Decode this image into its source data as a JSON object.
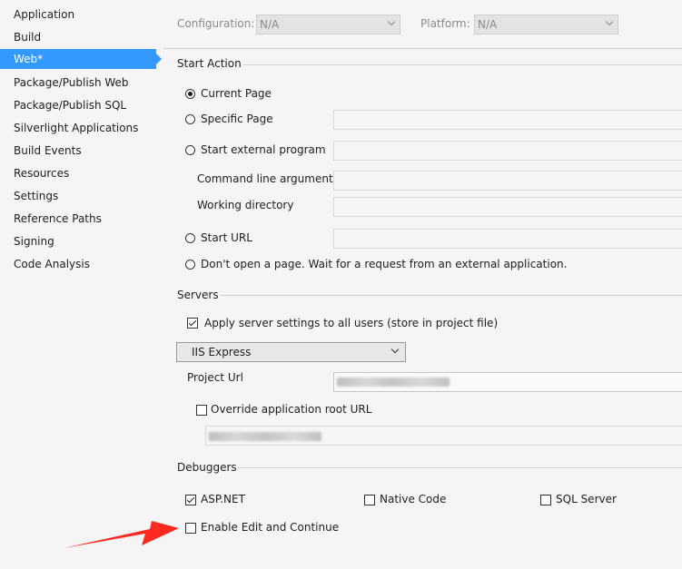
{
  "sidebar": {
    "items": [
      {
        "label": "Application"
      },
      {
        "label": "Build"
      },
      {
        "label": "Web*"
      },
      {
        "label": "Package/Publish Web"
      },
      {
        "label": "Package/Publish SQL"
      },
      {
        "label": "Silverlight Applications"
      },
      {
        "label": "Build Events"
      },
      {
        "label": "Resources"
      },
      {
        "label": "Settings"
      },
      {
        "label": "Reference Paths"
      },
      {
        "label": "Signing"
      },
      {
        "label": "Code Analysis"
      }
    ],
    "active_index": 2
  },
  "topbar": {
    "configuration_label": "Configuration:",
    "configuration_value": "N/A",
    "platform_label": "Platform:",
    "platform_value": "N/A"
  },
  "start_action": {
    "title": "Start Action",
    "current_page": "Current Page",
    "specific_page": "Specific Page",
    "start_external_program": "Start external program",
    "command_line_arguments": "Command line arguments",
    "working_directory": "Working directory",
    "start_url": "Start URL",
    "dont_open": "Don't open a page.  Wait for a request from an external application.",
    "selected": "current_page"
  },
  "servers": {
    "title": "Servers",
    "apply_settings": "Apply server settings to all users (store in project file)",
    "apply_settings_checked": true,
    "server_value": "IIS Express",
    "project_url_label": "Project Url",
    "override_root": "Override application root URL",
    "override_root_checked": false
  },
  "debuggers": {
    "title": "Debuggers",
    "aspnet": "ASP.NET",
    "aspnet_checked": true,
    "native_code": "Native Code",
    "native_code_checked": false,
    "sql_server": "SQL Server",
    "sql_server_checked": false,
    "edit_continue": "Enable Edit and Continue",
    "edit_continue_checked": false
  },
  "colors": {
    "accent": "#3399ff",
    "arrow": "#ff2a1f",
    "background": "#f5f5f5"
  }
}
